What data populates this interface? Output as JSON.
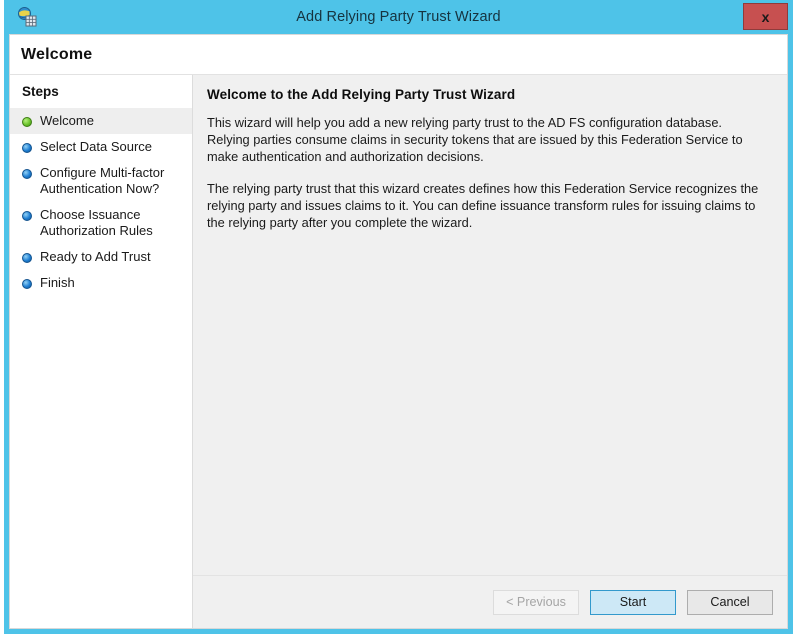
{
  "window": {
    "title": "Add Relying Party Trust Wizard",
    "icon": "adfs-globe-icon",
    "close_label": "x",
    "frame_color": "#4ec3e8",
    "close_color": "#c75050"
  },
  "page": {
    "header_title": "Welcome"
  },
  "sidebar": {
    "heading": "Steps",
    "items": [
      {
        "label": "Welcome",
        "state": "current",
        "bullet": "green"
      },
      {
        "label": "Select Data Source",
        "state": "pending",
        "bullet": "blue"
      },
      {
        "label": "Configure Multi-factor\nAuthentication Now?",
        "state": "pending",
        "bullet": "blue"
      },
      {
        "label": "Choose Issuance\nAuthorization Rules",
        "state": "pending",
        "bullet": "blue"
      },
      {
        "label": "Ready to Add Trust",
        "state": "pending",
        "bullet": "blue"
      },
      {
        "label": "Finish",
        "state": "pending",
        "bullet": "blue"
      }
    ]
  },
  "main": {
    "title": "Welcome to the Add Relying Party Trust Wizard",
    "paragraphs": [
      "This wizard will help you add a new relying party trust to the AD FS configuration database.  Relying parties consume claims in security tokens that are issued by this Federation Service to make authentication and authorization decisions.",
      "The relying party trust that this wizard creates defines how this Federation Service recognizes the relying party and issues claims to it. You can define issuance transform rules for issuing claims to the relying party after you complete the wizard."
    ]
  },
  "footer": {
    "previous_label": "< Previous",
    "start_label": "Start",
    "cancel_label": "Cancel",
    "previous_enabled": false,
    "start_is_default": true
  }
}
